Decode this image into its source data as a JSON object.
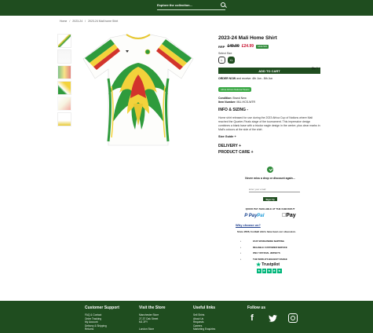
{
  "header": {
    "search_placeholder": "Explore the collection...",
    "search_icon": "search-icon"
  },
  "breadcrumb": [
    "Home",
    "/",
    "2023-24",
    "/",
    "2023-24 Mali home Shirt"
  ],
  "product": {
    "title": "2023-24 Mali Home Shirt",
    "price_label": "RRP",
    "old_price": "£49.99",
    "new_price": "£24.99",
    "discount_badge": "SAVE 50%",
    "select_size_label": "Select Size",
    "sizes": [
      "L",
      "XL"
    ],
    "selected_size": "XL",
    "qty_label": "Qty  1  +",
    "add_to_cart": "ADD TO CART",
    "order_now_prefix": "ORDER NOW",
    "order_now_text": " and receive: 4th Jun - 8th Jun",
    "africa_badge": "Africa African National Teams",
    "condition_label": "Condition:",
    "condition_value": "Brand New",
    "item_number_label": "Item Number:",
    "item_number_value": "MLI-HCS-WTR",
    "info_heading": "INFO & SIZING -",
    "description": "Home shirt released for use during the 2023 Africa Cup of Nations where Mali reached the Quarter-Finals stage of the tournament. This impressive design combines a blank base with a tricolor eagle design in the centre, plus clear marks in Mali's colours at the side of the shirt.",
    "size_guide": "Size Guide +",
    "delivery": "DELIVERY +",
    "product_care": "PRODUCT CARE +"
  },
  "discount": {
    "heading": "Never miss a drop or discount again...",
    "email_placeholder": "Enter your email",
    "signup_label": "Sign Up",
    "quickpay": "QUICK PAY AVAILABLE AT THE CHECKOUT",
    "paypal_pay": "Pay",
    "paypal_pal": "Pal",
    "applepay": "Pay"
  },
  "why": {
    "heading": "Why choose us?",
    "since": "Since 2006, football shirts have been our obsession.",
    "usps": [
      "FAST WORLDWIDE SHIPPING",
      "RELIABLE CUSTOMER SERVICE",
      "ONLY OFFICIAL JERSEYS",
      "THE WORLD'S BIGGEST RANGE"
    ]
  },
  "trustpilot": {
    "name": "Trustpilot"
  },
  "footer": {
    "customer_support": {
      "title": "Customer Support",
      "links": [
        "FAQ & Contact",
        "Order Tracking",
        "My Account",
        "Delivery & Shipping",
        "Returns"
      ]
    },
    "visit_store": {
      "title": "Visit the Store",
      "lines": [
        "Manchester Store",
        "27-37 Oak Street",
        "M1 2FY",
        "",
        "London Store"
      ]
    },
    "useful_links": {
      "title": "Useful links",
      "links": [
        "Sell Shirts",
        "About Us",
        "Requests",
        "Careers",
        "Marketing Enquiries"
      ]
    },
    "follow_us": {
      "title": "Follow us"
    }
  },
  "colors": {
    "brand_green": "#1f4d1f",
    "sale_red": "#c8102e",
    "badge_green": "#2f8b3a",
    "trustpilot_green": "#00b67a"
  }
}
